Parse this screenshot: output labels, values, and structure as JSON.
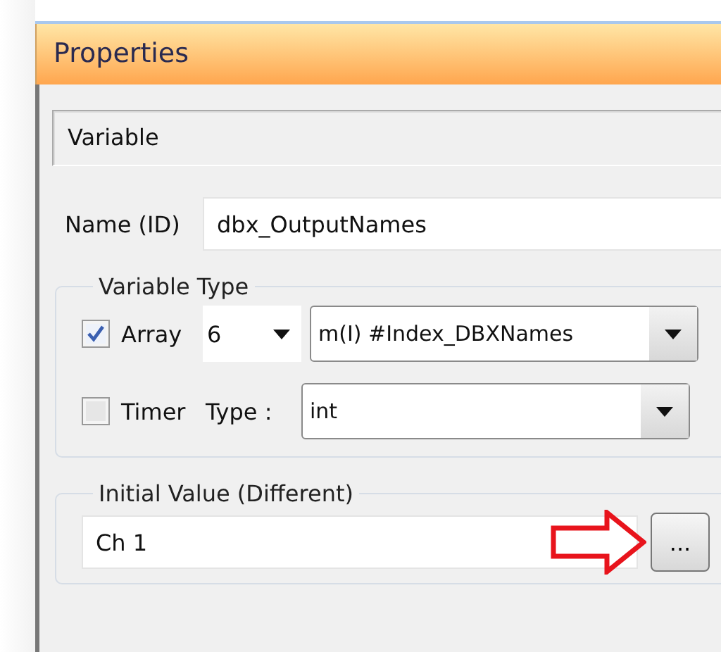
{
  "window": {
    "title": "Properties"
  },
  "section": {
    "title": "Variable"
  },
  "name_field": {
    "label": "Name (ID)",
    "value": "dbx_OutputNames"
  },
  "variable_type": {
    "title": "Variable Type",
    "array": {
      "label": "Array",
      "checked": true,
      "size": "6",
      "index": "m(I) #Index_DBXNames"
    },
    "timer": {
      "label": "Timer",
      "checked": false
    },
    "type": {
      "label": "Type :",
      "value": "int"
    }
  },
  "initial_value": {
    "title": "Initial Value (Different)",
    "value": "Ch 1",
    "button": "..."
  }
}
